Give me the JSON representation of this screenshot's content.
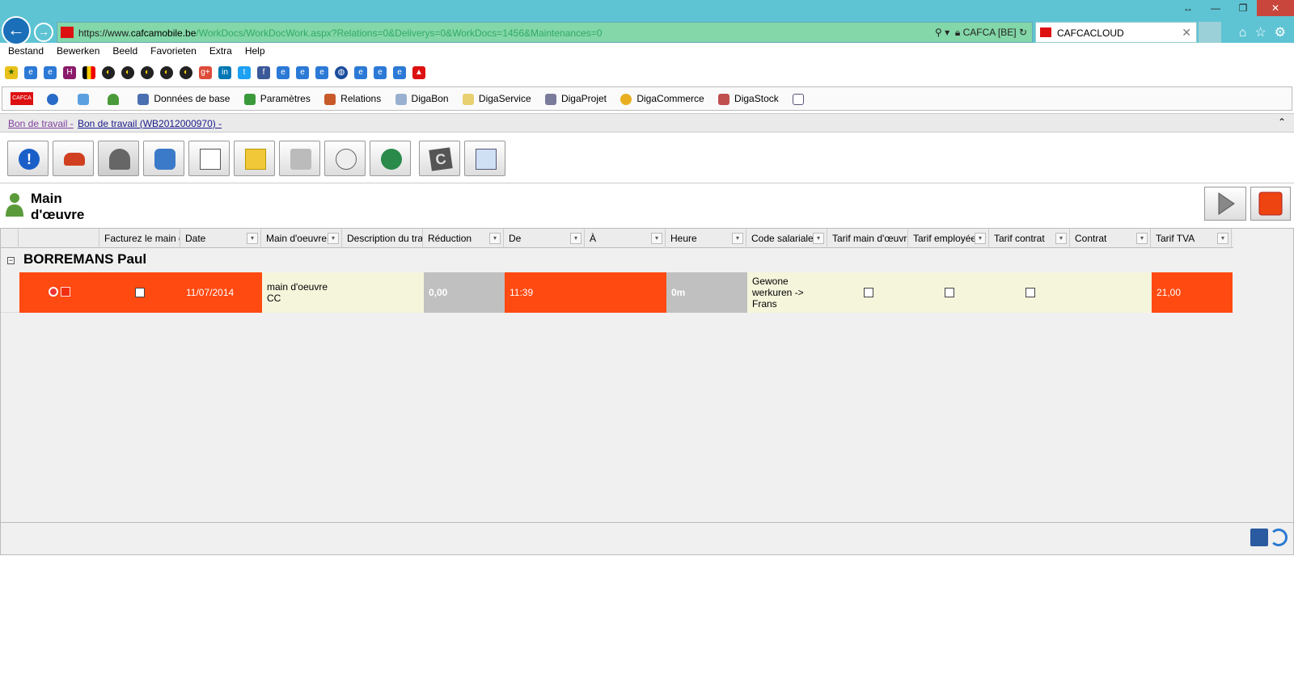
{
  "browser": {
    "url_scheme": "https://www.",
    "url_domain": "cafcamobile.be",
    "url_path": "/WorkDocs/WorkDocWork.aspx?Relations=0&Deliverys=0&WorkDocs=1456&Maintenances=0",
    "site_identity": "CAFCA [BE]",
    "tab_title": "CAFCACLOUD"
  },
  "menu": [
    "Bestand",
    "Bewerken",
    "Beeld",
    "Favorieten",
    "Extra",
    "Help"
  ],
  "app_toolbar": {
    "logo_text": "CAFCA",
    "items": [
      "Données de base",
      "Paramètres",
      "Relations",
      "DigaBon",
      "DigaService",
      "DigaProjet",
      "DigaCommerce",
      "DigaStock"
    ]
  },
  "breadcrumb": {
    "first": "Bon de travail -",
    "second": "Bon de travail (WB2012000970) -"
  },
  "section": {
    "title_line1": "Main",
    "title_line2": "d'œuvre"
  },
  "grid": {
    "columns": [
      "Facturez le main d",
      "Date",
      "Main d'oeuvre",
      "Description du tra",
      "Réduction",
      "De",
      "À",
      "Heure",
      "Code salariale",
      "Tarif main d'œuvr",
      "Tarif employée",
      "Tarif contrat",
      "Contrat",
      "Tarif TVA"
    ],
    "group_name": "BORREMANS Paul",
    "rows": [
      {
        "date": "11/07/2014",
        "labour_line1": "main d'oeuvre",
        "labour_line2": "CC",
        "reduction": "0,00",
        "from": "11:39",
        "hour": "0m",
        "code_line1": "Gewone",
        "code_line2": "werkuren ->",
        "code_line3": "Frans",
        "vat_rate": "21,00"
      }
    ]
  },
  "colors": {
    "orange": "#ff4a12",
    "cream": "#f5f5dc",
    "chrome": "#5ec4d4",
    "addressbar": "#83d7a8"
  }
}
